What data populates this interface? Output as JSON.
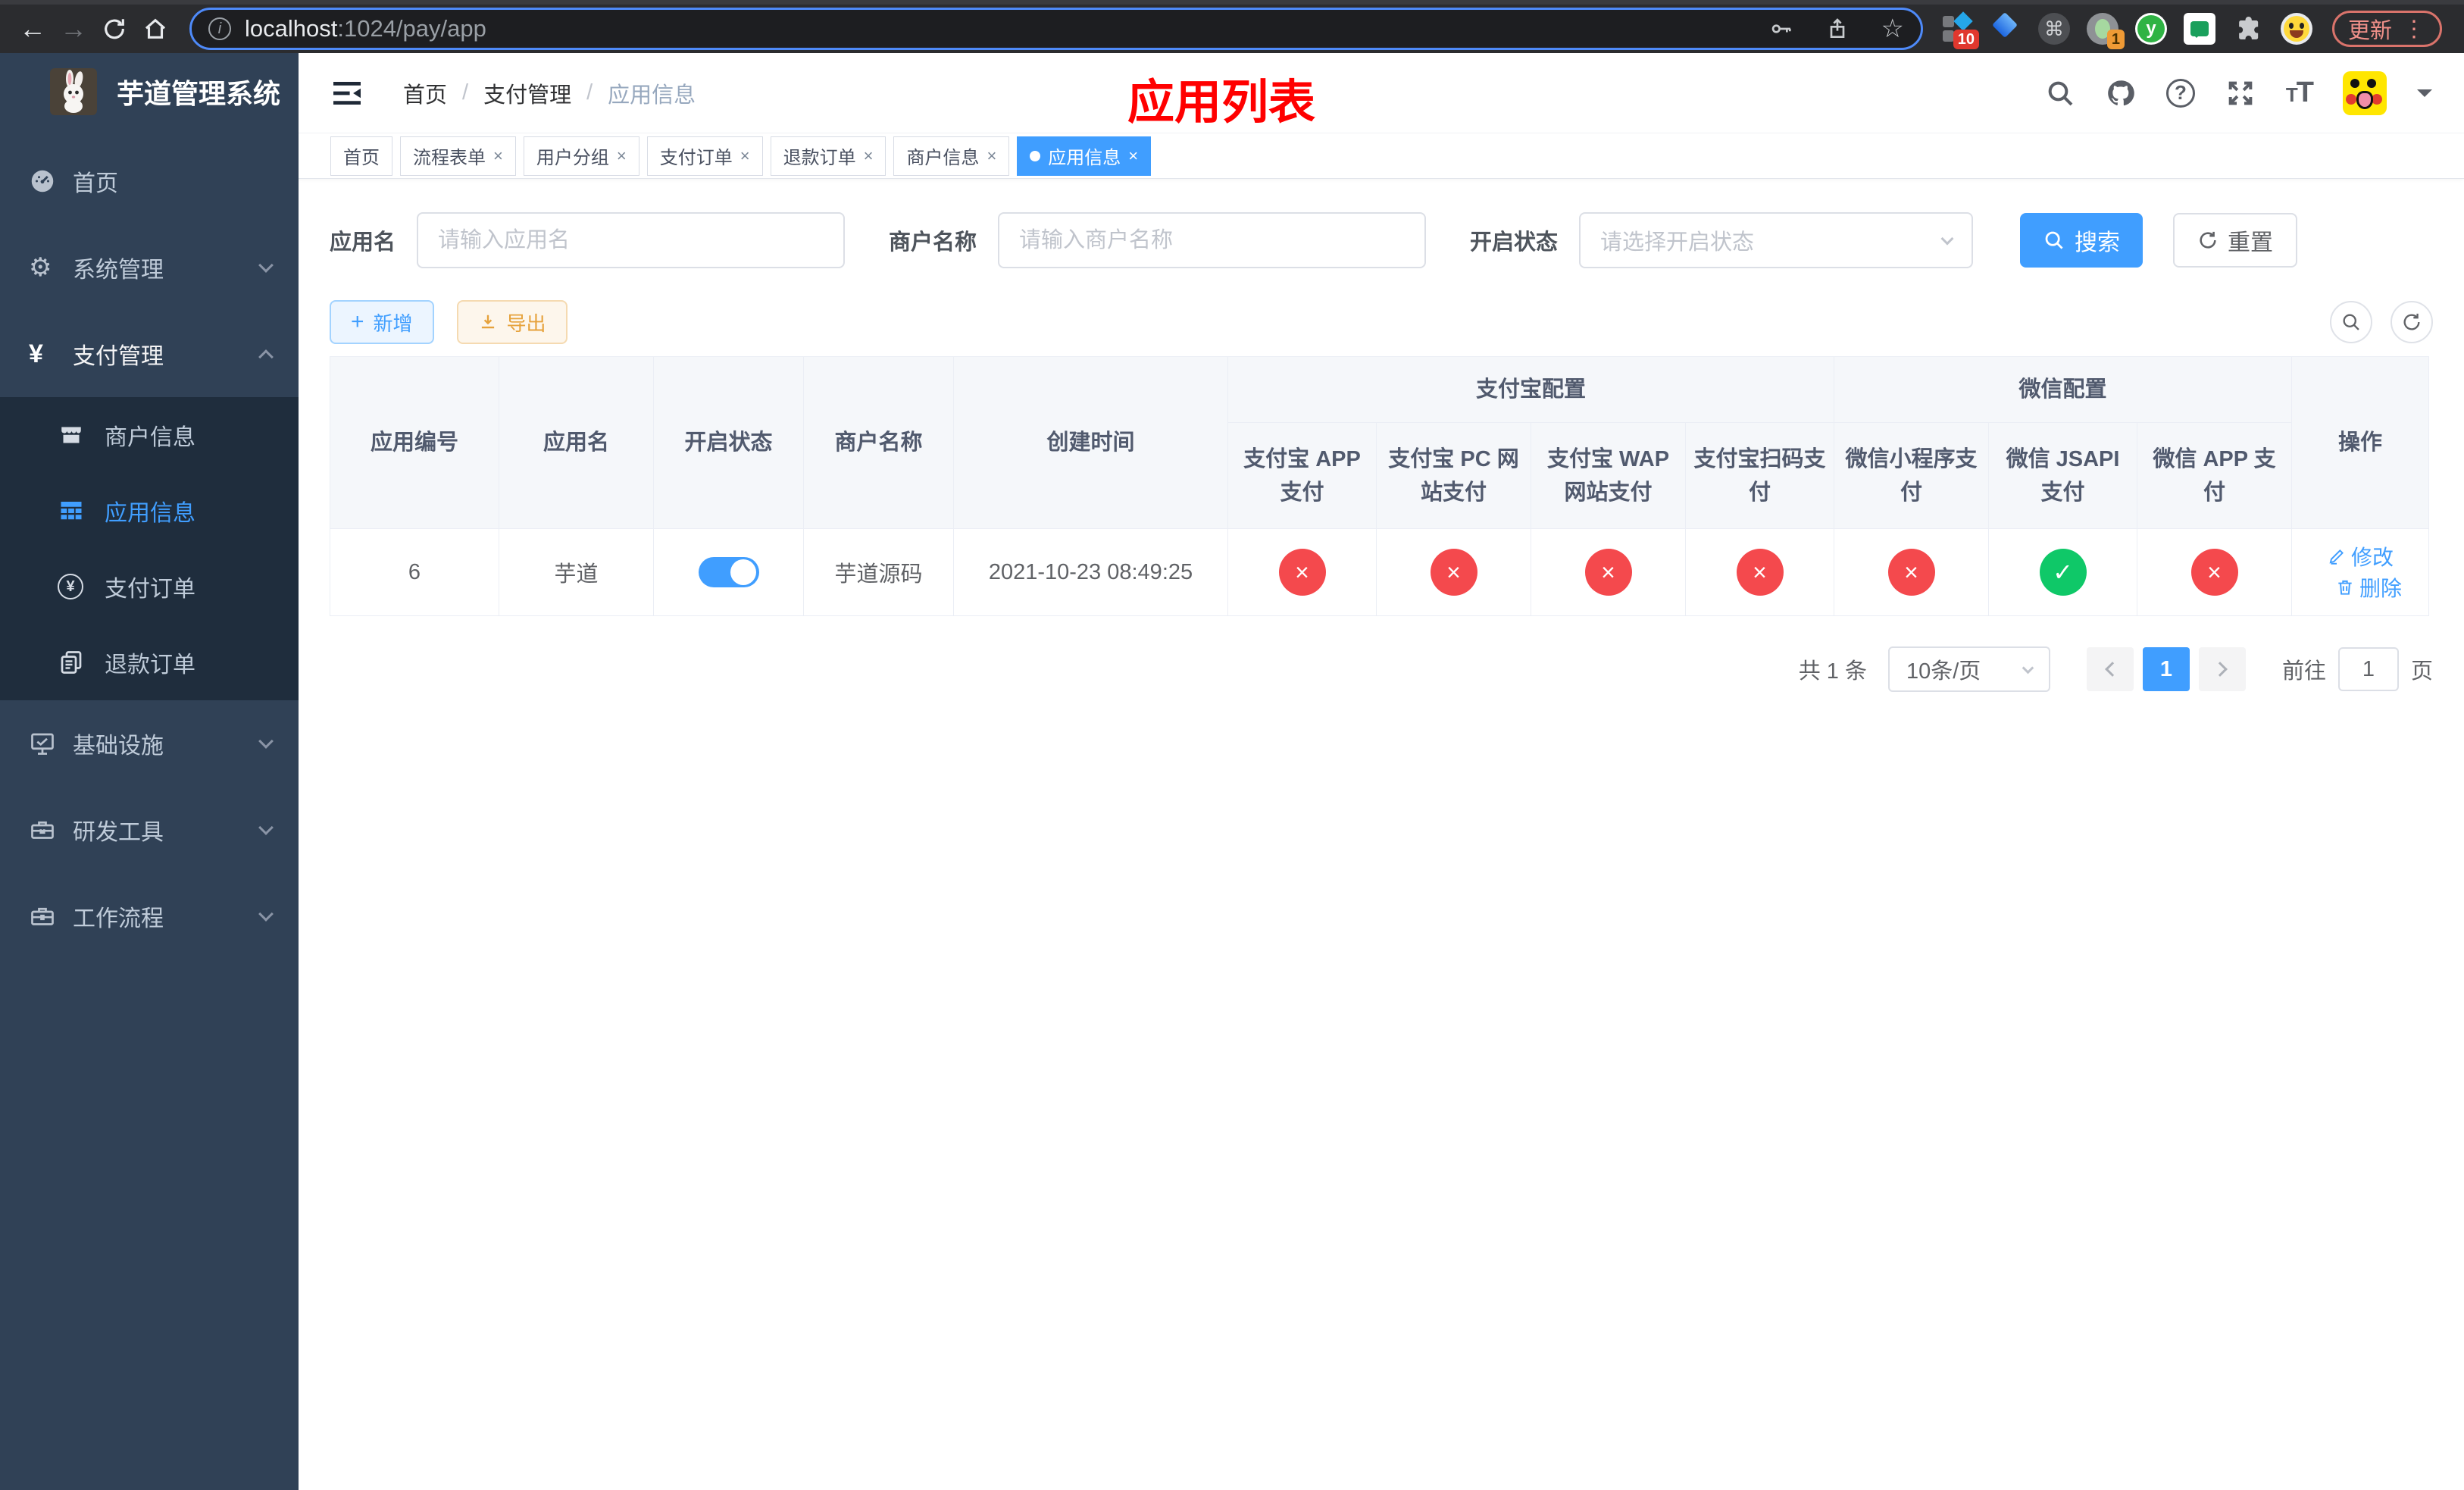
{
  "colors": {
    "primary": "#409eff",
    "success": "#0fc868",
    "danger": "#f4494d",
    "warning": "#e6a23c",
    "title_red": "#ff0000",
    "sidebar_bg": "#304156",
    "submenu_bg": "#1f2d3d"
  },
  "icons": {
    "close": "×",
    "check": "✓",
    "cross": "×",
    "yen": "¥",
    "plus": "+",
    "gear": "⚙",
    "star": "☆",
    "kebab": "⋮",
    "question": "?",
    "info": "i",
    "command": "⌘",
    "back": "←",
    "forward": "→",
    "slash": "/"
  },
  "browser": {
    "url_host": "localhost",
    "url_rest": ":1024/pay/app",
    "update_label": "更新",
    "ext_badge_10": "10",
    "ext_badge_1": "1",
    "ext_y_label": "y"
  },
  "sidebar": {
    "title": "芋道管理系统",
    "items": [
      {
        "label": "首页"
      },
      {
        "label": "系统管理"
      },
      {
        "label": "支付管理",
        "children": [
          {
            "label": "商户信息"
          },
          {
            "label": "应用信息",
            "active": true
          },
          {
            "label": "支付订单"
          },
          {
            "label": "退款订单"
          }
        ]
      },
      {
        "label": "基础设施"
      },
      {
        "label": "研发工具"
      },
      {
        "label": "工作流程"
      }
    ]
  },
  "header": {
    "breadcrumb": [
      "首页",
      "支付管理",
      "应用信息"
    ],
    "page_title": "应用列表"
  },
  "tabs": [
    {
      "label": "首页",
      "closable": false
    },
    {
      "label": "流程表单",
      "closable": true
    },
    {
      "label": "用户分组",
      "closable": true
    },
    {
      "label": "支付订单",
      "closable": true
    },
    {
      "label": "退款订单",
      "closable": true
    },
    {
      "label": "商户信息",
      "closable": true
    },
    {
      "label": "应用信息",
      "closable": true,
      "active": true
    }
  ],
  "filters": {
    "app_name_label": "应用名",
    "app_name_placeholder": "请输入应用名",
    "merchant_label": "商户名称",
    "merchant_placeholder": "请输入商户名称",
    "status_label": "开启状态",
    "status_placeholder": "请选择开启状态",
    "search_label": "搜索",
    "reset_label": "重置"
  },
  "toolbar": {
    "add_label": "新增",
    "export_label": "导出"
  },
  "table": {
    "headers": {
      "app_id": "应用编号",
      "app_name": "应用名",
      "status": "开启状态",
      "merchant": "商户名称",
      "created": "创建时间",
      "group_alipay": "支付宝配置",
      "group_wechat": "微信配置",
      "sub": [
        "支付宝 APP 支付",
        "支付宝 PC 网站支付",
        "支付宝 WAP 网站支付",
        "支付宝扫码支付",
        "微信小程序支付",
        "微信 JSAPI 支付",
        "微信 APP 支付"
      ],
      "ops": "操作"
    },
    "row": {
      "app_id": "6",
      "app_name": "芋道",
      "enabled": true,
      "merchant": "芋道源码",
      "created": "2021-10-23 08:49:25",
      "statuses": [
        "no",
        "no",
        "no",
        "no",
        "no",
        "yes",
        "no"
      ],
      "edit_label": "修改",
      "delete_label": "删除"
    }
  },
  "pagination": {
    "total": "共 1 条",
    "page_size": "10条/页",
    "page": "1",
    "goto_label": "前往",
    "goto_value": "1",
    "page_unit": "页"
  }
}
